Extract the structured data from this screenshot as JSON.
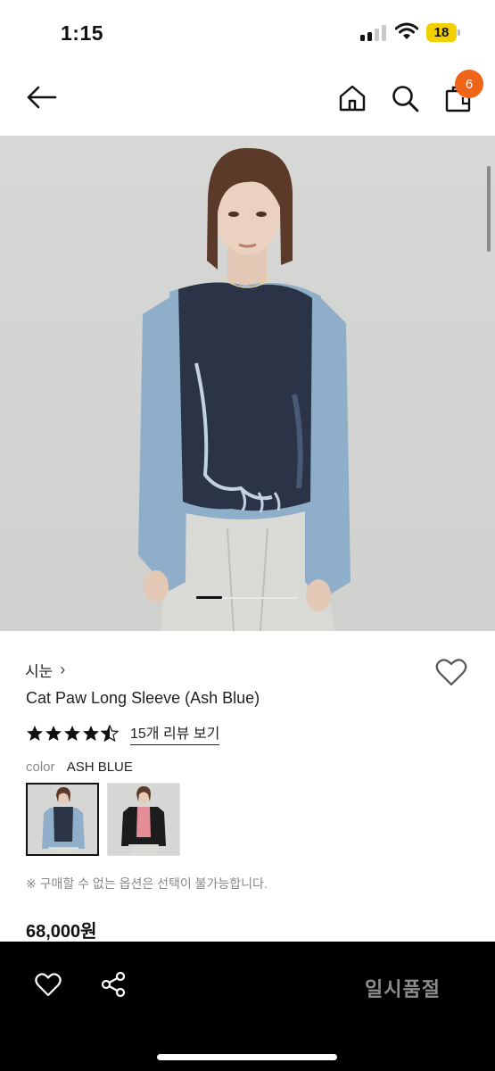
{
  "status_bar": {
    "time": "1:15",
    "battery": "18"
  },
  "nav": {
    "back_icon": "back-arrow-icon",
    "home_icon": "home-icon",
    "search_icon": "search-icon",
    "cart_icon": "shopping-bag-icon",
    "cart_count": "6"
  },
  "gallery": {
    "current_index": 1,
    "image_count": 4
  },
  "product": {
    "brand": "시눈",
    "brand_chevron": "›",
    "name": "Cat Paw Long Sleeve (Ash Blue)",
    "rating": 4.5,
    "review_link": "15개 리뷰 보기",
    "color_label": "color",
    "color_value": "ASH BLUE",
    "notice": "※ 구매할 수 없는 옵션은 선택이 불가능합니다.",
    "price": "68,000원"
  },
  "bottom_bar": {
    "like_icon": "heart-icon",
    "share_icon": "share-icon",
    "status_label": "일시품절"
  },
  "colors": {
    "accent": "#f06418",
    "bottom_bar": "#000000",
    "battery": "#f2d000"
  }
}
